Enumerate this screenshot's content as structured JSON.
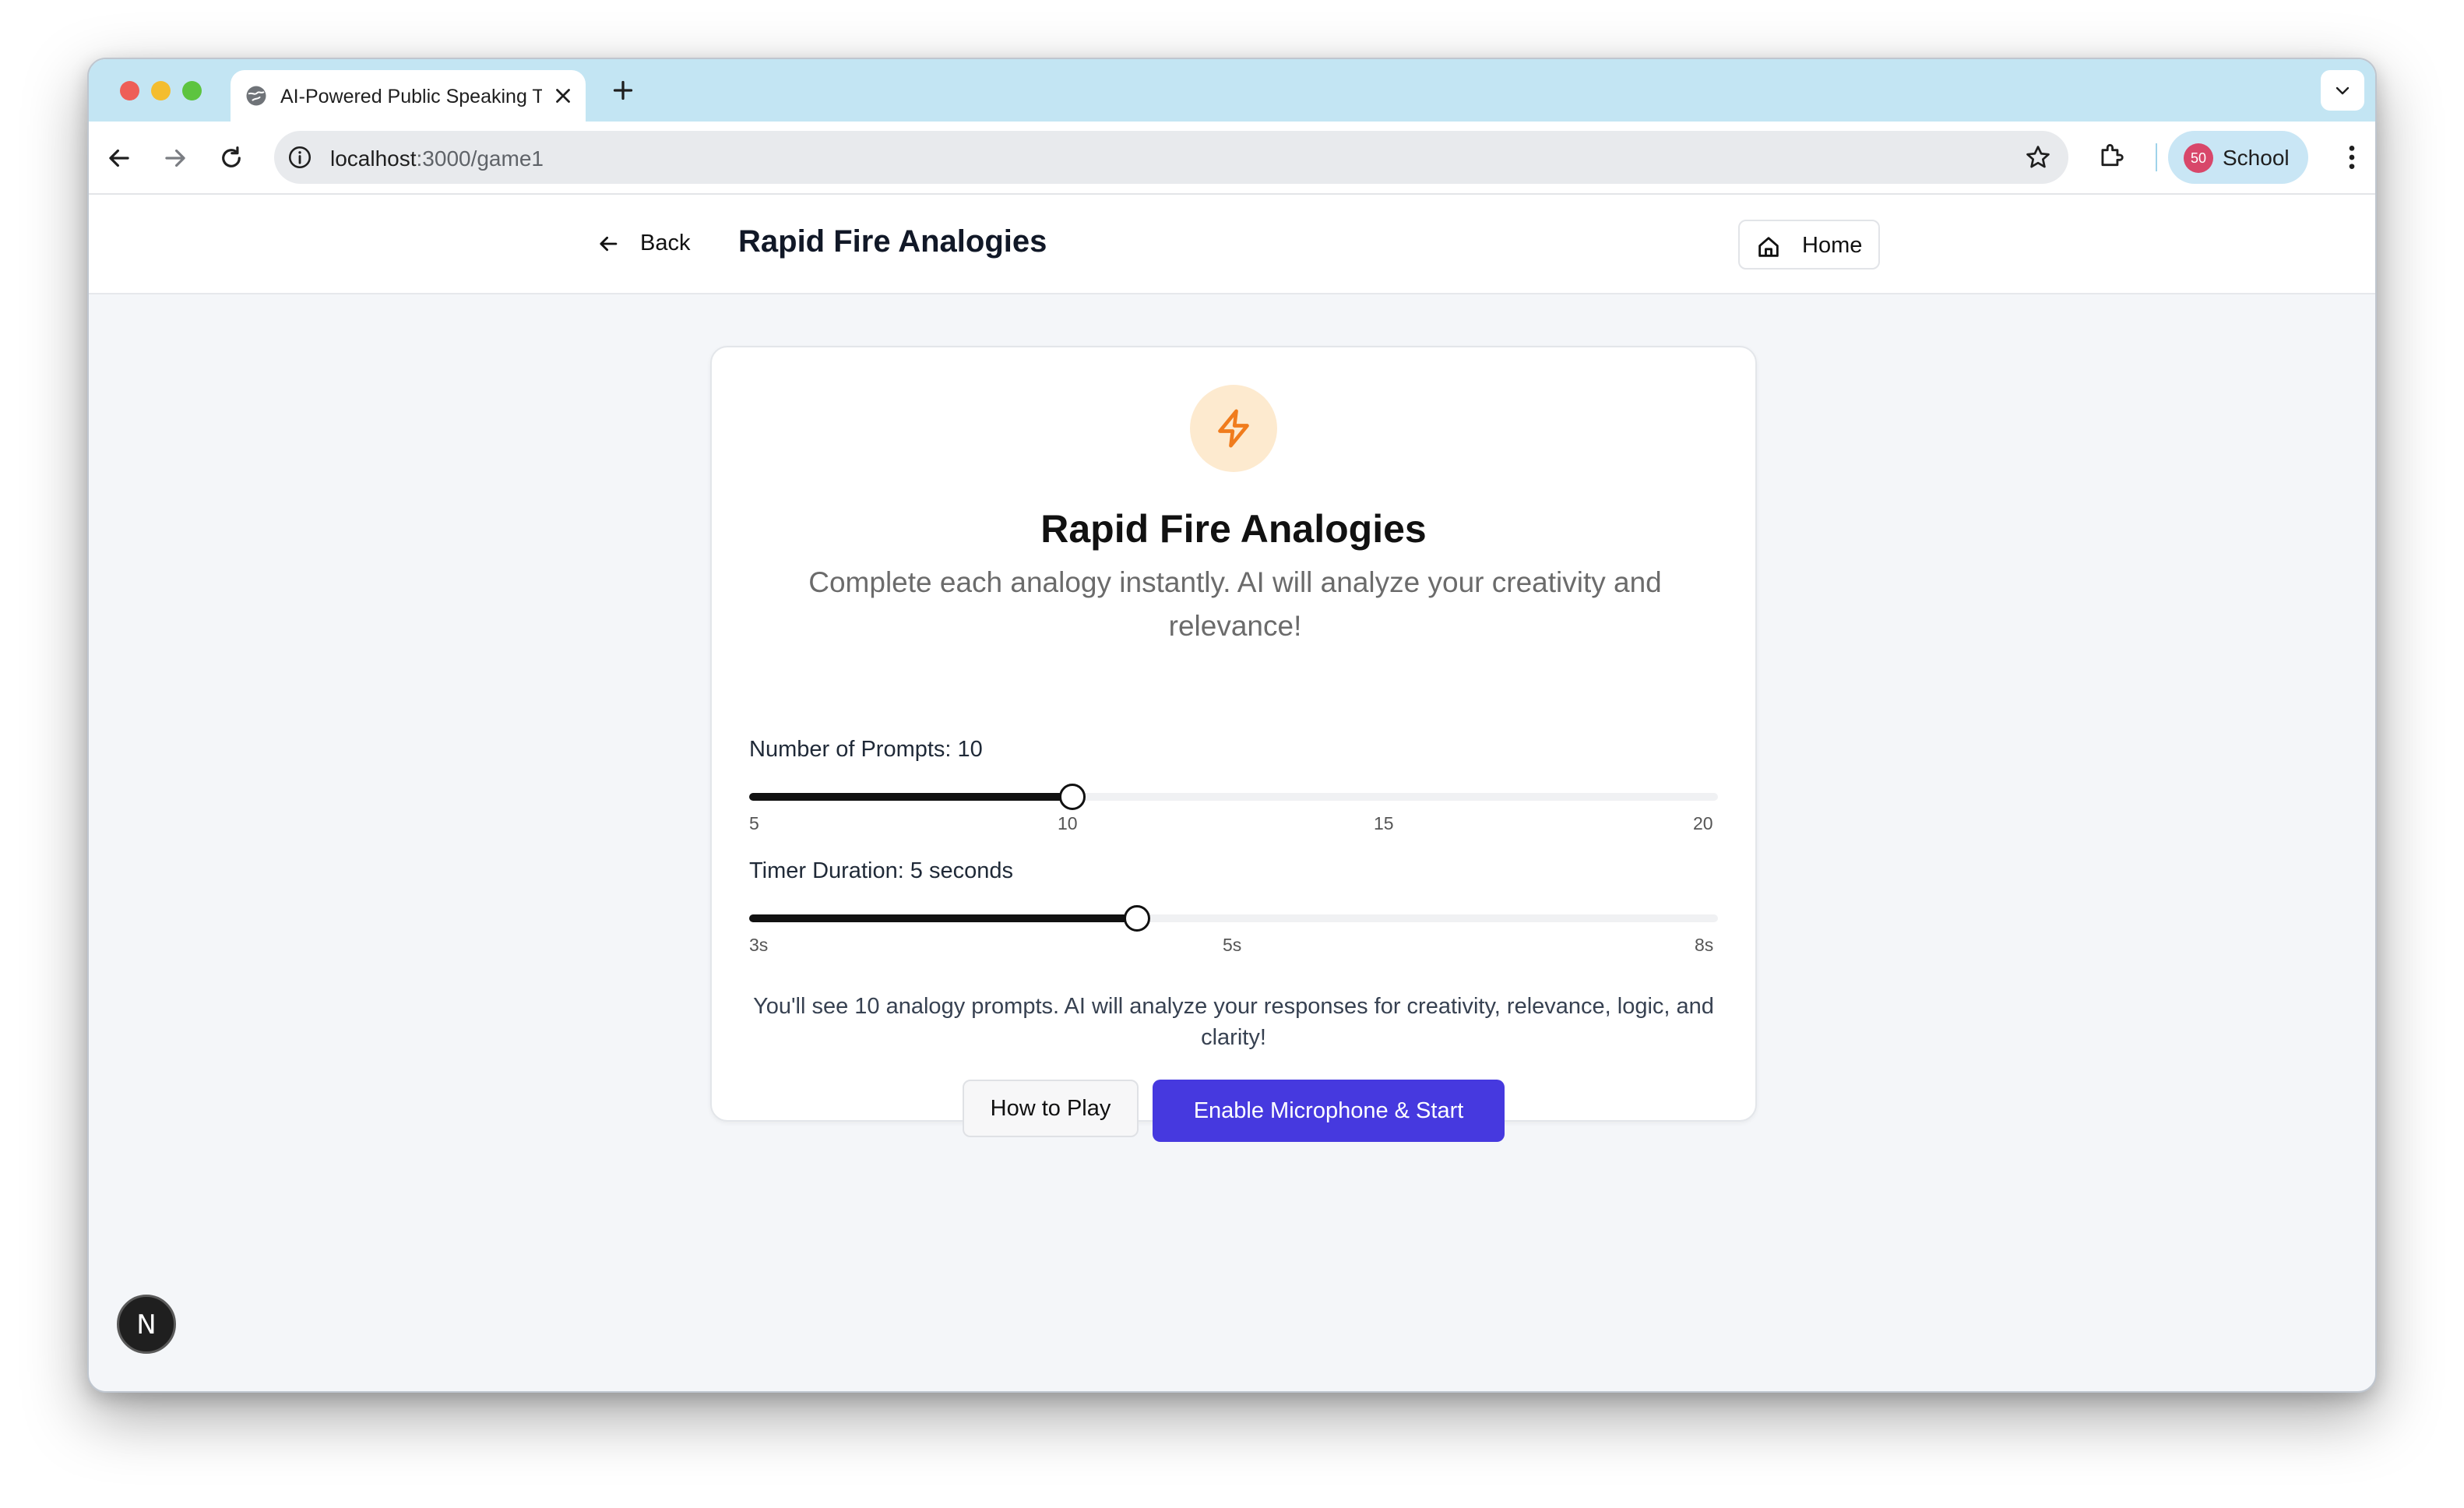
{
  "browser": {
    "tab_title": "AI-Powered Public Speaking Tr",
    "url_host": "localhost",
    "url_path": ":3000/game1",
    "profile_badge": "50",
    "profile_label": "School"
  },
  "header": {
    "back_label": "Back",
    "title": "Rapid Fire Analogies",
    "home_label": "Home"
  },
  "card": {
    "icon": "lightning-bolt-icon",
    "title": "Rapid Fire Analogies",
    "description": "Complete each analogy instantly. AI will analyze your creativity and relevance!",
    "prompts_slider": {
      "label": "Number of Prompts: 10",
      "min": 5,
      "max": 20,
      "value": 10,
      "ticks": [
        "5",
        "10",
        "15",
        "20"
      ]
    },
    "timer_slider": {
      "label": "Timer Duration: 5 seconds",
      "min": 3,
      "max": 8,
      "value": 5,
      "ticks": [
        "3s",
        "5s",
        "8s"
      ]
    },
    "summary": "You'll see 10 analogy prompts. AI will analyze your responses for creativity, relevance, logic, and clarity!",
    "how_to_play_label": "How to Play",
    "start_label": "Enable Microphone & Start"
  },
  "dev_badge": "N",
  "colors": {
    "accent": "#4639df",
    "bolt": "#f07c1d",
    "bolt_bg": "#fdeacf"
  }
}
